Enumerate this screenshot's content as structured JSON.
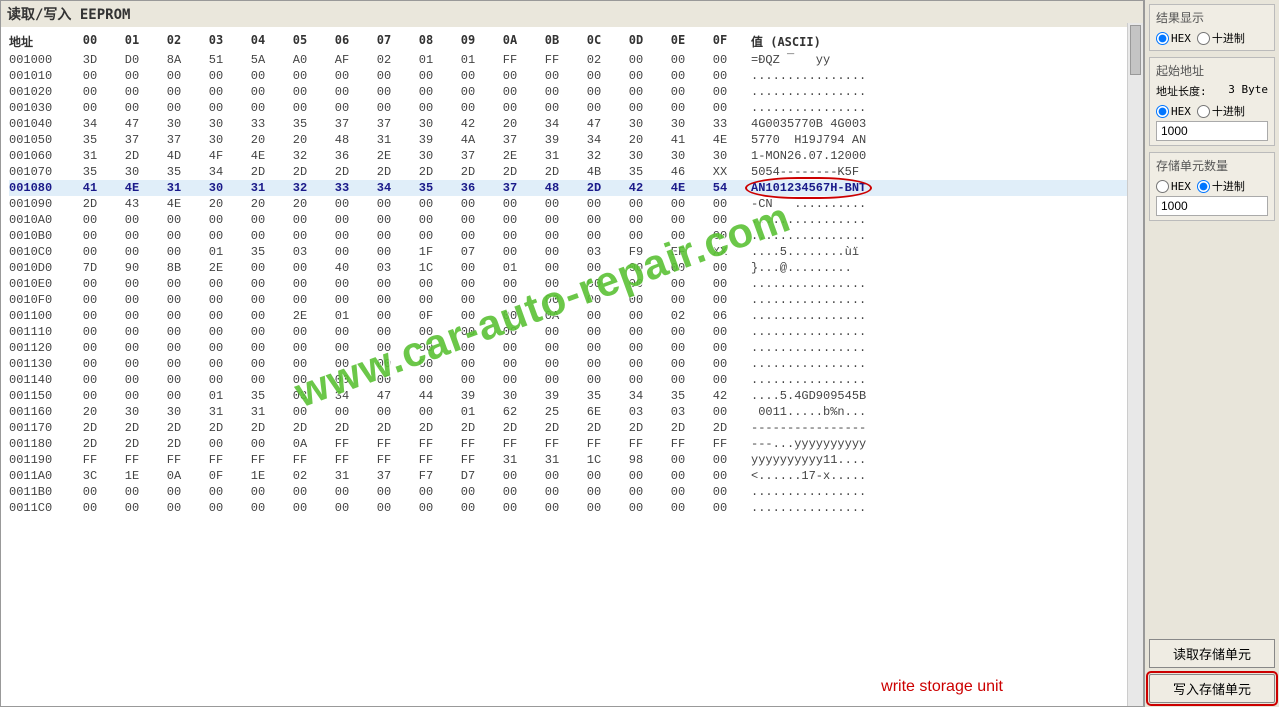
{
  "title": "读取/写入 EEPROM",
  "header": {
    "addr": "地址",
    "cols": [
      "00",
      "01",
      "02",
      "03",
      "04",
      "05",
      "06",
      "07",
      "08",
      "09",
      "0A",
      "0B",
      "0C",
      "0D",
      "0E",
      "0F"
    ],
    "ascii": "值 (ASCII)"
  },
  "rows": [
    {
      "addr": "001000",
      "bytes": [
        "3D",
        "D0",
        "8A",
        "51",
        "5A",
        "A0",
        "AF",
        "02",
        "01",
        "01",
        "FF",
        "FF",
        "02",
        "00",
        "00",
        "00"
      ],
      "ascii": "=ÐQZ ¯   yy"
    },
    {
      "addr": "001010",
      "bytes": [
        "00",
        "00",
        "00",
        "00",
        "00",
        "00",
        "00",
        "00",
        "00",
        "00",
        "00",
        "00",
        "00",
        "00",
        "00",
        "00"
      ],
      "ascii": "................"
    },
    {
      "addr": "001020",
      "bytes": [
        "00",
        "00",
        "00",
        "00",
        "00",
        "00",
        "00",
        "00",
        "00",
        "00",
        "00",
        "00",
        "00",
        "00",
        "00",
        "00"
      ],
      "ascii": "................"
    },
    {
      "addr": "001030",
      "bytes": [
        "00",
        "00",
        "00",
        "00",
        "00",
        "00",
        "00",
        "00",
        "00",
        "00",
        "00",
        "00",
        "00",
        "00",
        "00",
        "00"
      ],
      "ascii": "................"
    },
    {
      "addr": "001040",
      "bytes": [
        "34",
        "47",
        "30",
        "30",
        "33",
        "35",
        "37",
        "37",
        "30",
        "42",
        "20",
        "34",
        "47",
        "30",
        "30",
        "33"
      ],
      "ascii": "4G0035770B 4G003"
    },
    {
      "addr": "001050",
      "bytes": [
        "35",
        "37",
        "37",
        "30",
        "20",
        "20",
        "48",
        "31",
        "39",
        "4A",
        "37",
        "39",
        "34",
        "20",
        "41",
        "4E"
      ],
      "ascii": "5770  H19J794 AN"
    },
    {
      "addr": "001060",
      "bytes": [
        "31",
        "2D",
        "4D",
        "4F",
        "4E",
        "32",
        "36",
        "2E",
        "30",
        "37",
        "2E",
        "31",
        "32",
        "30",
        "30",
        "30"
      ],
      "ascii": "1-MON26.07.12000"
    },
    {
      "addr": "001070",
      "bytes": [
        "35",
        "30",
        "35",
        "34",
        "2D",
        "2D",
        "2D",
        "2D",
        "2D",
        "2D",
        "2D",
        "2D",
        "4B",
        "35",
        "46",
        "XX"
      ],
      "ascii": "5054--------K5F"
    },
    {
      "addr": "001080",
      "bytes": [
        "41",
        "4E",
        "31",
        "30",
        "31",
        "32",
        "33",
        "34",
        "35",
        "36",
        "37",
        "48",
        "2D",
        "42",
        "4E",
        "54"
      ],
      "ascii": "AN101234567H-BNT",
      "hl": true,
      "circ": true
    },
    {
      "addr": "001090",
      "bytes": [
        "2D",
        "43",
        "4E",
        "20",
        "20",
        "20",
        "00",
        "00",
        "00",
        "00",
        "00",
        "00",
        "00",
        "00",
        "00",
        "00"
      ],
      "ascii": "-CN   .........."
    },
    {
      "addr": "0010A0",
      "bytes": [
        "00",
        "00",
        "00",
        "00",
        "00",
        "00",
        "00",
        "00",
        "00",
        "00",
        "00",
        "00",
        "00",
        "00",
        "00",
        "00"
      ],
      "ascii": "................"
    },
    {
      "addr": "0010B0",
      "bytes": [
        "00",
        "00",
        "00",
        "00",
        "00",
        "00",
        "00",
        "00",
        "00",
        "00",
        "00",
        "00",
        "00",
        "00",
        "00",
        "00"
      ],
      "ascii": "................"
    },
    {
      "addr": "0010C0",
      "bytes": [
        "00",
        "00",
        "00",
        "01",
        "35",
        "03",
        "00",
        "00",
        "1F",
        "07",
        "00",
        "00",
        "03",
        "F9",
        "EF",
        "XX"
      ],
      "ascii": "....5........ùï"
    },
    {
      "addr": "0010D0",
      "bytes": [
        "7D",
        "90",
        "8B",
        "2E",
        "00",
        "00",
        "40",
        "03",
        "1C",
        "00",
        "01",
        "00",
        "00",
        "00",
        "00",
        "00"
      ],
      "ascii": "}...@........."
    },
    {
      "addr": "0010E0",
      "bytes": [
        "00",
        "00",
        "00",
        "00",
        "00",
        "00",
        "00",
        "00",
        "00",
        "00",
        "00",
        "00",
        "00",
        "00",
        "00",
        "00"
      ],
      "ascii": "................"
    },
    {
      "addr": "0010F0",
      "bytes": [
        "00",
        "00",
        "00",
        "00",
        "00",
        "00",
        "00",
        "00",
        "00",
        "00",
        "00",
        "00",
        "00",
        "00",
        "00",
        "00"
      ],
      "ascii": "................"
    },
    {
      "addr": "001100",
      "bytes": [
        "00",
        "00",
        "00",
        "00",
        "00",
        "2E",
        "01",
        "00",
        "0F",
        "00",
        "00",
        "0A",
        "00",
        "00",
        "02",
        "06"
      ],
      "ascii": "................"
    },
    {
      "addr": "001110",
      "bytes": [
        "00",
        "00",
        "00",
        "00",
        "00",
        "00",
        "00",
        "00",
        "00",
        "00",
        "00",
        "00",
        "00",
        "00",
        "00",
        "00"
      ],
      "ascii": "................"
    },
    {
      "addr": "001120",
      "bytes": [
        "00",
        "00",
        "00",
        "00",
        "00",
        "00",
        "00",
        "00",
        "00",
        "00",
        "00",
        "00",
        "00",
        "00",
        "00",
        "00"
      ],
      "ascii": "................"
    },
    {
      "addr": "001130",
      "bytes": [
        "00",
        "00",
        "00",
        "00",
        "00",
        "00",
        "00",
        "00",
        "00",
        "00",
        "00",
        "00",
        "00",
        "00",
        "00",
        "00"
      ],
      "ascii": "................"
    },
    {
      "addr": "001140",
      "bytes": [
        "00",
        "00",
        "00",
        "00",
        "00",
        "00",
        "00",
        "00",
        "00",
        "00",
        "00",
        "00",
        "00",
        "00",
        "00",
        "00"
      ],
      "ascii": "................"
    },
    {
      "addr": "001150",
      "bytes": [
        "00",
        "00",
        "00",
        "01",
        "35",
        "03",
        "34",
        "47",
        "44",
        "39",
        "30",
        "39",
        "35",
        "34",
        "35",
        "42"
      ],
      "ascii": "....5.4GD909545B"
    },
    {
      "addr": "001160",
      "bytes": [
        "20",
        "30",
        "30",
        "31",
        "31",
        "00",
        "00",
        "00",
        "00",
        "01",
        "62",
        "25",
        "6E",
        "03",
        "03",
        "00"
      ],
      "ascii": " 0011.....b%n..."
    },
    {
      "addr": "001170",
      "bytes": [
        "2D",
        "2D",
        "2D",
        "2D",
        "2D",
        "2D",
        "2D",
        "2D",
        "2D",
        "2D",
        "2D",
        "2D",
        "2D",
        "2D",
        "2D",
        "2D"
      ],
      "ascii": "----------------"
    },
    {
      "addr": "001180",
      "bytes": [
        "2D",
        "2D",
        "2D",
        "00",
        "00",
        "0A",
        "FF",
        "FF",
        "FF",
        "FF",
        "FF",
        "FF",
        "FF",
        "FF",
        "FF",
        "FF"
      ],
      "ascii": "---...yyyyyyyyyy"
    },
    {
      "addr": "001190",
      "bytes": [
        "FF",
        "FF",
        "FF",
        "FF",
        "FF",
        "FF",
        "FF",
        "FF",
        "FF",
        "FF",
        "31",
        "31",
        "1C",
        "98",
        "00",
        "00"
      ],
      "ascii": "yyyyyyyyyy11...."
    },
    {
      "addr": "0011A0",
      "bytes": [
        "3C",
        "1E",
        "0A",
        "0F",
        "1E",
        "02",
        "31",
        "37",
        "F7",
        "D7",
        "00",
        "00",
        "00",
        "00",
        "00",
        "00"
      ],
      "ascii": "<......17-x....."
    },
    {
      "addr": "0011B0",
      "bytes": [
        "00",
        "00",
        "00",
        "00",
        "00",
        "00",
        "00",
        "00",
        "00",
        "00",
        "00",
        "00",
        "00",
        "00",
        "00",
        "00"
      ],
      "ascii": "................"
    },
    {
      "addr": "0011C0",
      "bytes": [
        "00",
        "00",
        "00",
        "00",
        "00",
        "00",
        "00",
        "00",
        "00",
        "00",
        "00",
        "00",
        "00",
        "00",
        "00",
        "00"
      ],
      "ascii": "................"
    }
  ],
  "side": {
    "result_title": "结果显示",
    "hex": "HEX",
    "dec": "十进制",
    "start_addr_title": "起始地址",
    "addr_len_label": "地址长度:",
    "addr_len_value": "3 Byte",
    "addr_value": "1000",
    "units_title": "存储单元数量",
    "units_value": "1000",
    "read_btn": "读取存储单元",
    "write_btn": "写入存储单元"
  },
  "watermark": "www.car-auto-repair.com",
  "annotation": "write storage unit"
}
